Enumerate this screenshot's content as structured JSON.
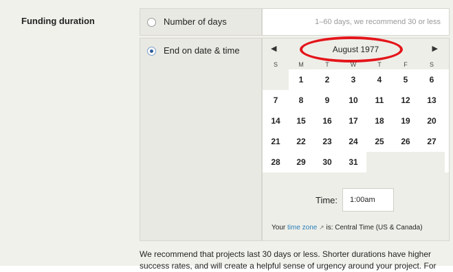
{
  "section": {
    "label": "Funding duration"
  },
  "options": {
    "days": {
      "label": "Number of days",
      "placeholder": "1–60 days, we recommend 30 or less"
    },
    "end_date": {
      "label": "End on date & time",
      "checked": true
    }
  },
  "calendar": {
    "prev": "◀",
    "next": "▶",
    "month": "August 1977",
    "weekdays": [
      "S",
      "M",
      "T",
      "W",
      "T",
      "F",
      "S"
    ],
    "days": [
      "1",
      "2",
      "3",
      "4",
      "5",
      "6",
      "7",
      "8",
      "9",
      "10",
      "11",
      "12",
      "13",
      "14",
      "15",
      "16",
      "17",
      "18",
      "19",
      "20",
      "21",
      "22",
      "23",
      "24",
      "25",
      "26",
      "27",
      "28",
      "29",
      "30",
      "31"
    ],
    "first_weekday_index": 1
  },
  "time": {
    "label": "Time:",
    "value": "1:00am"
  },
  "timezone": {
    "prefix": "Your",
    "link": "time zone",
    "icon": "external-link-icon",
    "suffix": "is: Central Time (US & Canada)"
  },
  "description": "We recommend that projects last 30 days or less. Shorter durations have higher success rates, and will create a helpful sense of urgency around your project. For",
  "colors": {
    "annotation": "#e4151b",
    "link": "#2a7fb8"
  }
}
